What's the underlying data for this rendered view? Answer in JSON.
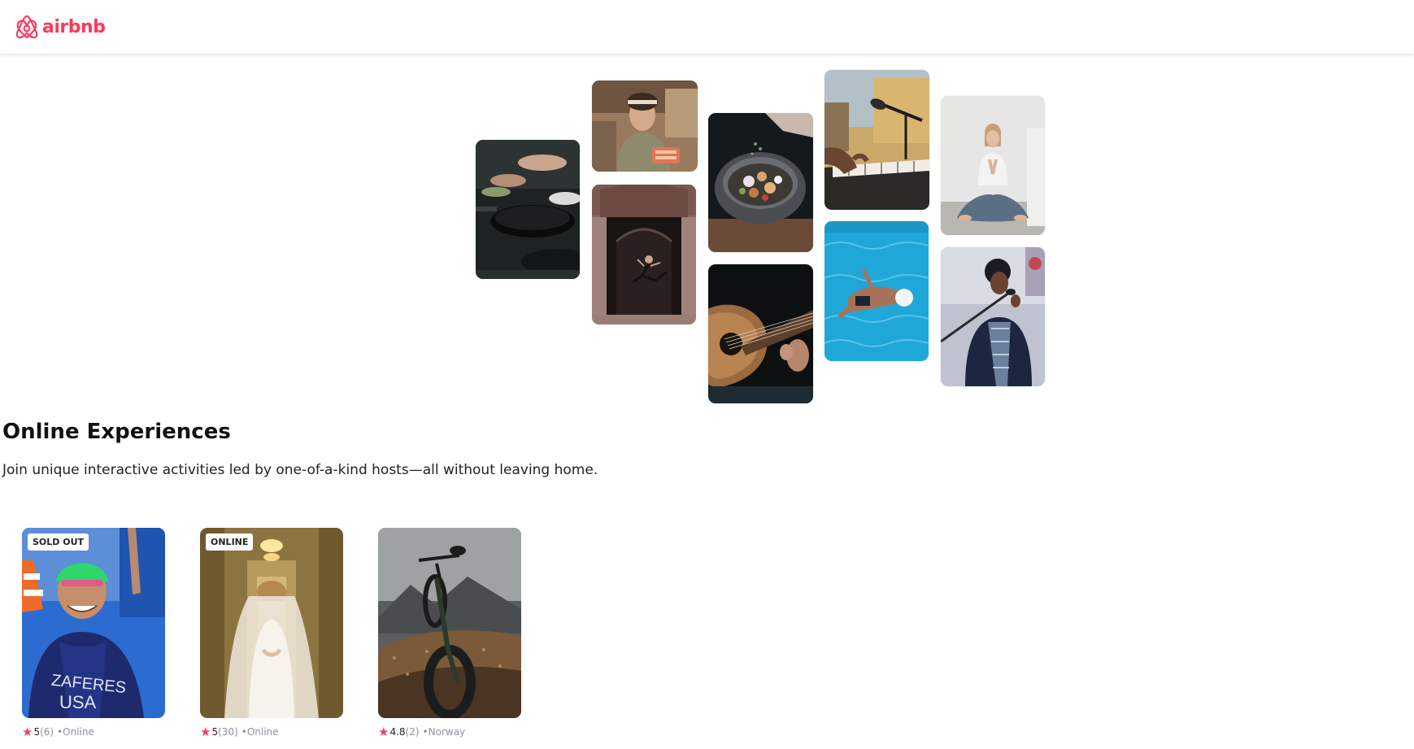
{
  "navbar": {
    "logo_text": "airbnb",
    "logo_icon": "airbnb-belo-icon",
    "brand_color": "#ff385c"
  },
  "hero": {
    "photos": [
      "cooking-pans",
      "smiling-woman-kitchen",
      "ballet-dancer-doorway",
      "spice-bowl",
      "acoustic-guitar",
      "microphone-piano",
      "swimmer-pool",
      "yoga-meditation",
      "singer-microphone"
    ]
  },
  "section": {
    "title": "Online Experiences",
    "subtitle": "Join unique interactive activities led by one-of-a-kind hosts—all without leaving home."
  },
  "cards": [
    {
      "badge": "SOLD OUT",
      "rating": "5",
      "count": "(6)",
      "location": "•Online",
      "photo": "swimmer-portrait"
    },
    {
      "badge": "ONLINE",
      "rating": "5",
      "count": "(30)",
      "location": "•Online",
      "photo": "bride-portrait"
    },
    {
      "badge": "",
      "rating": "4.8",
      "count": "(2)",
      "location": "•Norway",
      "photo": "mountain-bike"
    }
  ],
  "colors": {
    "star": "#fe395c",
    "muted_text": "#918e9b"
  }
}
